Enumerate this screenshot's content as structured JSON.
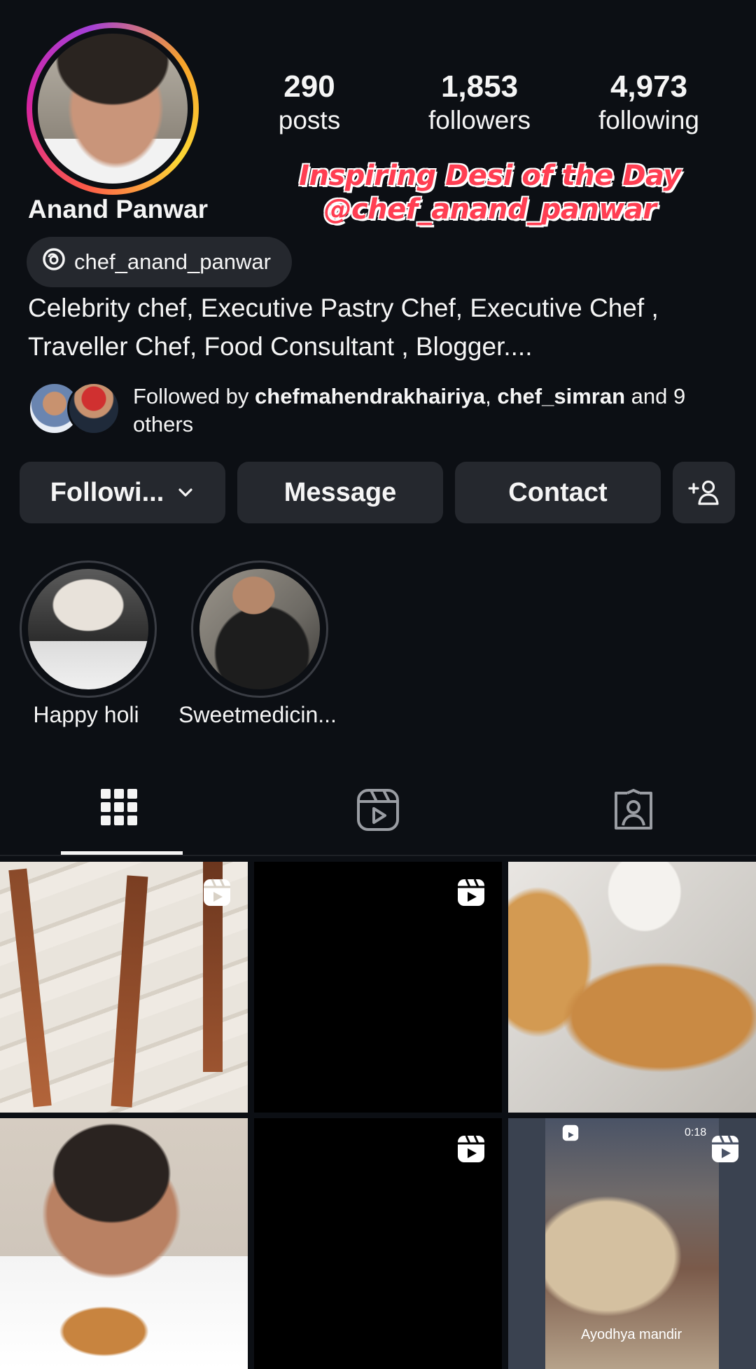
{
  "profile": {
    "name": "Anand Panwar",
    "threads_handle": "chef_anand_panwar",
    "bio_line1": "Celebrity chef, Executive Pastry Chef, Executive Chef ,",
    "bio_line2": "Traveller Chef, Food Consultant , Blogger....",
    "stats": [
      {
        "value": "290",
        "label": "posts"
      },
      {
        "value": "1,853",
        "label": "followers"
      },
      {
        "value": "4,973",
        "label": "following"
      }
    ]
  },
  "overlay": {
    "line1": "Inspiring Desi of the Day",
    "line2": "@chef_anand_panwar"
  },
  "followed_by": {
    "prefix": "Followed by ",
    "user1": "chefmahendrakhairiya",
    "sep": ", ",
    "user2": "chef_simran",
    "suffix": " and 9 others"
  },
  "actions": {
    "following": "Followi...",
    "message": "Message",
    "contact": "Contact",
    "add_user_icon": "add-person-icon"
  },
  "highlights": [
    {
      "label": "Happy holi"
    },
    {
      "label": "Sweetmedicin..."
    }
  ],
  "tabs": [
    "grid-icon",
    "reels-icon",
    "tagged-icon"
  ],
  "grid": {
    "reel_duration": "0:18",
    "caption": "Ayodhya mandir"
  },
  "colors": {
    "background": "#0c0f14",
    "button": "#25282e",
    "overlay_text": "#ff3e52"
  }
}
